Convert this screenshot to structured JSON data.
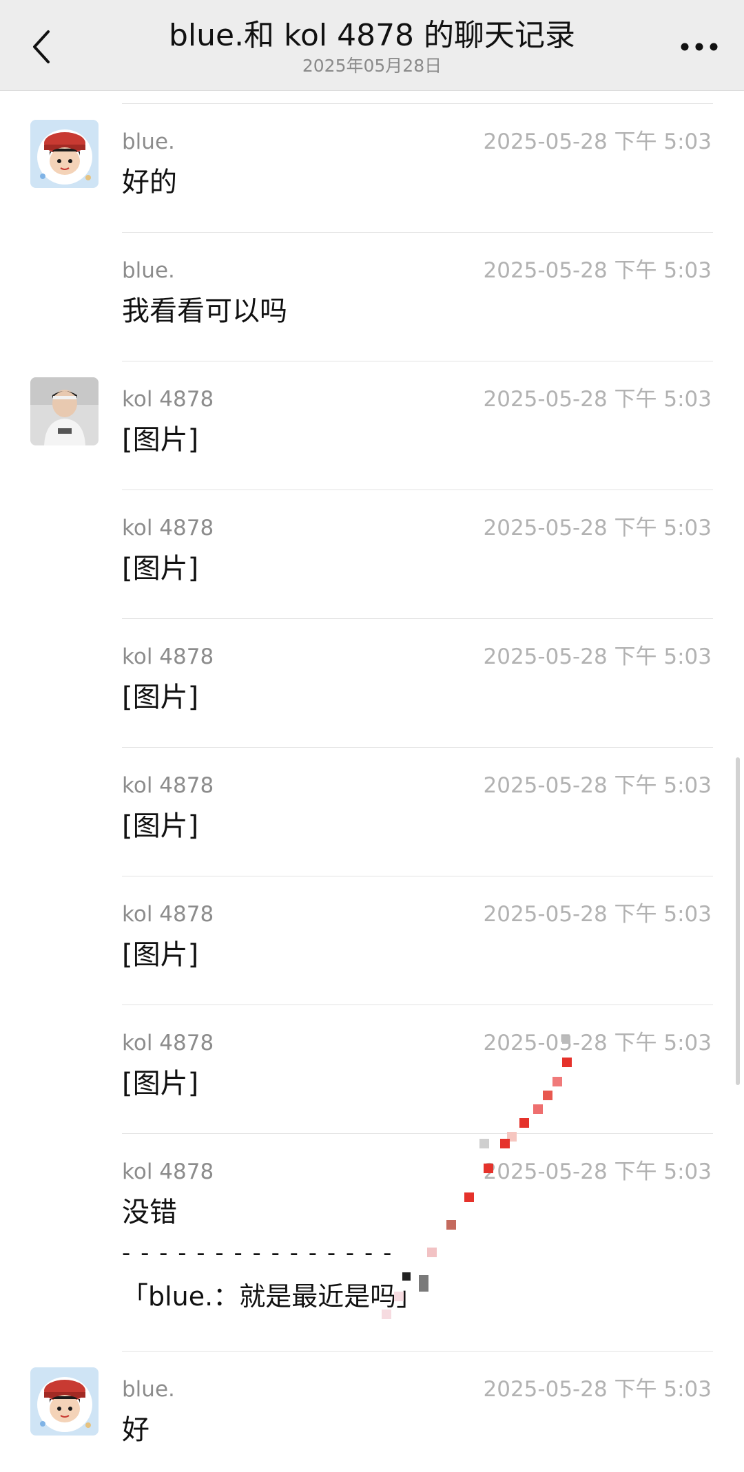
{
  "header": {
    "title": "blue.和 kol 4878 的聊天记录",
    "subtitle": "2025年05月28日",
    "back_icon": "chevron-left-icon",
    "more_icon": "more-dots-icon"
  },
  "messages": [
    {
      "sender": "blue.",
      "time": "2025-05-28 下午 5:03",
      "text": "好的",
      "avatar": "avatar-blue"
    },
    {
      "sender": "blue.",
      "time": "2025-05-28 下午 5:03",
      "text": "我看看可以吗"
    },
    {
      "sender": "kol 4878",
      "time": "2025-05-28 下午 5:03",
      "text": "[图片]",
      "avatar": "avatar-kol"
    },
    {
      "sender": "kol 4878",
      "time": "2025-05-28 下午 5:03",
      "text": "[图片]"
    },
    {
      "sender": "kol 4878",
      "time": "2025-05-28 下午 5:03",
      "text": "[图片]"
    },
    {
      "sender": "kol 4878",
      "time": "2025-05-28 下午 5:03",
      "text": "[图片]"
    },
    {
      "sender": "kol 4878",
      "time": "2025-05-28 下午 5:03",
      "text": "[图片]"
    },
    {
      "sender": "kol 4878",
      "time": "2025-05-28 下午 5:03",
      "text": "[图片]"
    },
    {
      "sender": "kol 4878",
      "time": "2025-05-28 下午 5:03",
      "text": "没错",
      "quote_divider": "- - - - - - - - - - - - - - -",
      "quote": "「blue.：就是最近是吗」"
    },
    {
      "sender": "blue.",
      "time": "2025-05-28 下午 5:03",
      "text": "好",
      "avatar": "avatar-blue"
    }
  ],
  "colors": {
    "header_bg": "#ededed",
    "separator": "#e2e2e2",
    "sender_text": "#8c8c8c",
    "time_text": "#b2b2b2"
  }
}
